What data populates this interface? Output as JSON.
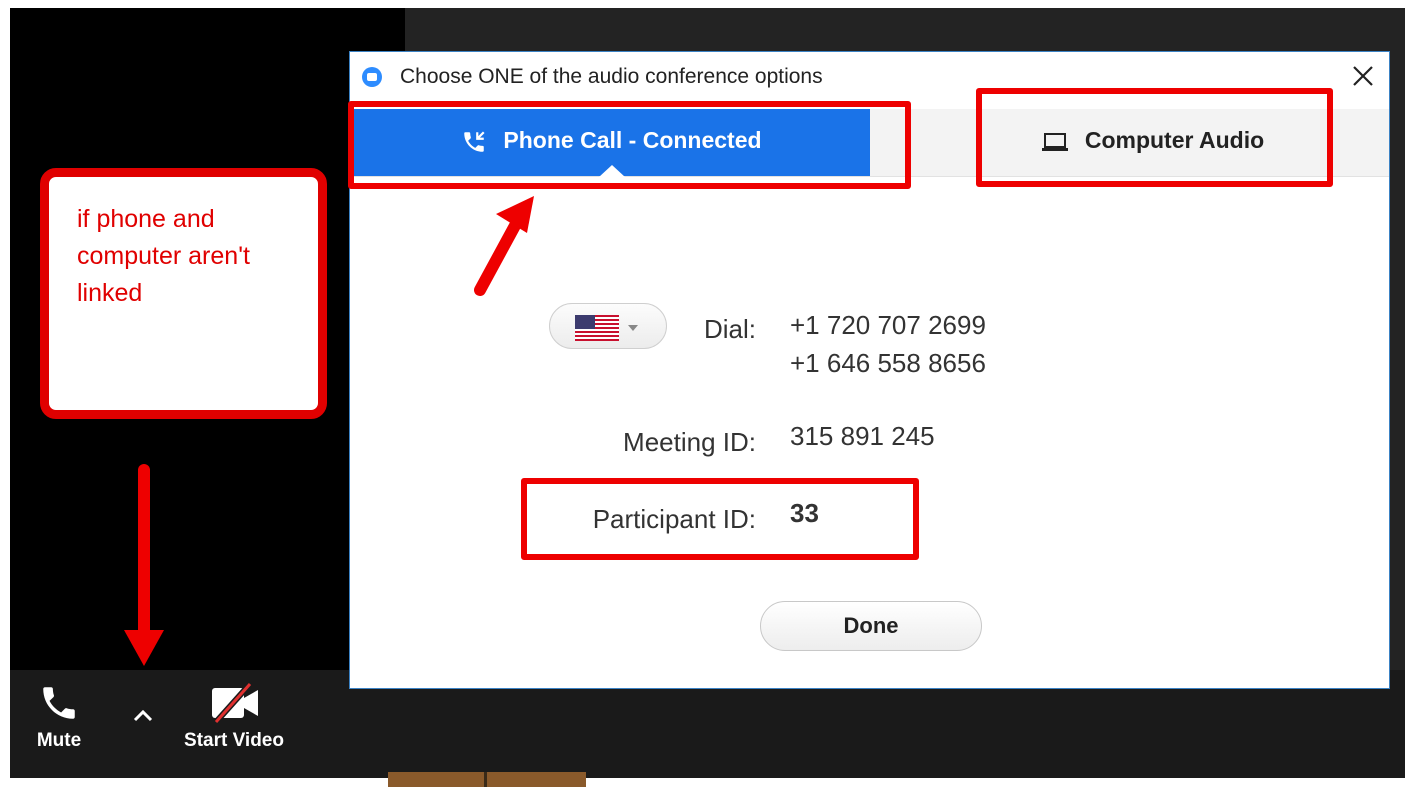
{
  "dialog": {
    "title": "Choose ONE of the audio conference options",
    "tabs": {
      "phone_call": "Phone Call - Connected",
      "computer_audio": "Computer Audio"
    },
    "country_icon": "us-flag-icon",
    "dial_label": "Dial:",
    "dial_numbers": [
      "+1 720 707 2699",
      "+1 646 558 8656"
    ],
    "meeting_id_label": "Meeting ID:",
    "meeting_id": "315 891 245",
    "participant_id_label": "Participant ID:",
    "participant_id": "33",
    "done_label": "Done"
  },
  "toolbar": {
    "mute_label": "Mute",
    "start_video_label": "Start Video"
  },
  "annotation": {
    "note_text": "if phone and computer aren't linked",
    "color": "#ee0000"
  },
  "colors": {
    "accent": "#1a73e8",
    "toolbar_bg": "#1a1a1a"
  }
}
